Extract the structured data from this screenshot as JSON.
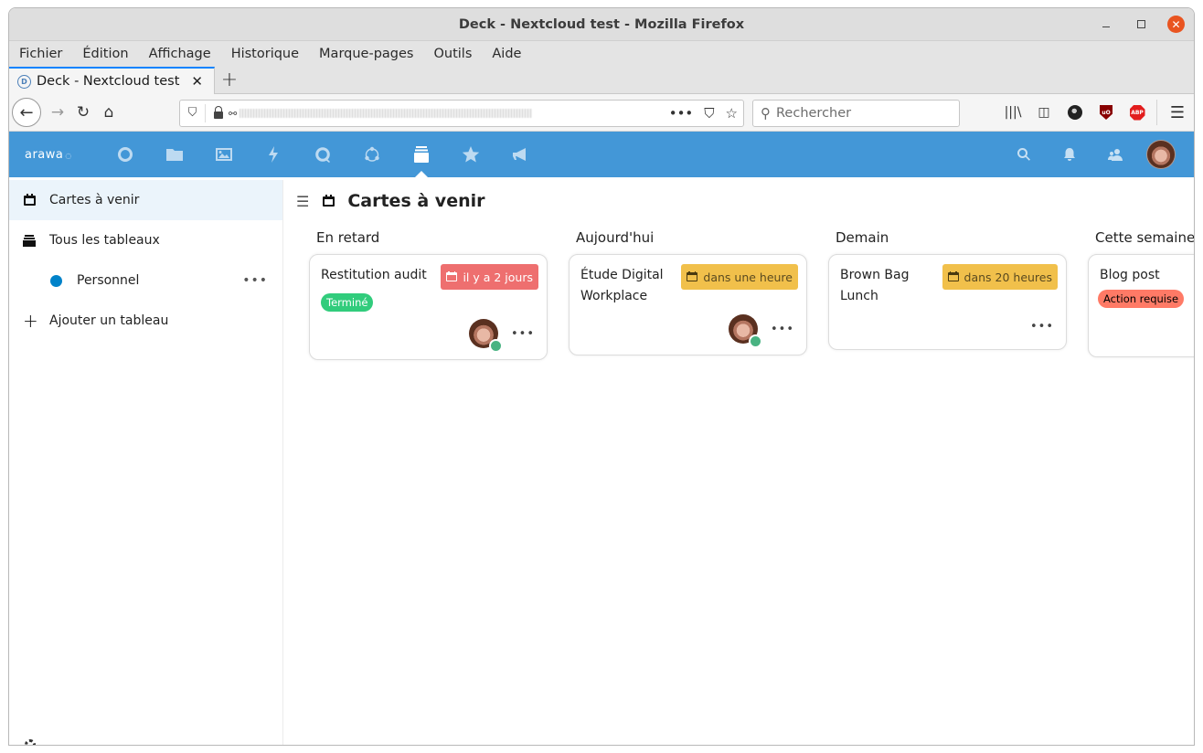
{
  "window": {
    "title": "Deck - Nextcloud test - Mozilla Firefox"
  },
  "menubar": {
    "items": [
      "Fichier",
      "Édition",
      "Affichage",
      "Historique",
      "Marque-pages",
      "Outils",
      "Aide"
    ]
  },
  "tabs": [
    {
      "title": "Deck - Nextcloud test",
      "icon": "deck-favicon",
      "active": true
    }
  ],
  "navbar": {
    "search_placeholder": "Rechercher",
    "url_obscured": true
  },
  "nextcloud": {
    "logo": "arawa",
    "apps": [
      {
        "name": "dashboard",
        "icon": "circle-icon",
        "active": false
      },
      {
        "name": "files",
        "icon": "folder-icon",
        "active": false
      },
      {
        "name": "photos",
        "icon": "image-icon",
        "active": false
      },
      {
        "name": "activity",
        "icon": "bolt-icon",
        "active": false
      },
      {
        "name": "talk",
        "icon": "talk-icon",
        "active": false
      },
      {
        "name": "circles",
        "icon": "circles-icon",
        "active": false
      },
      {
        "name": "deck",
        "icon": "deck-icon",
        "active": true
      },
      {
        "name": "favorites",
        "icon": "star-icon",
        "active": false
      },
      {
        "name": "announcements",
        "icon": "megaphone-icon",
        "active": false
      }
    ],
    "accent": "#4397d7"
  },
  "sidebar": {
    "items": [
      {
        "label": "Cartes à venir",
        "icon": "calendar-icon",
        "active": true
      },
      {
        "label": "Tous les tableaux",
        "icon": "deck-icon",
        "active": false
      },
      {
        "label": "Personnel",
        "icon": "board-color-dot",
        "color": "#0082c9",
        "sub": true
      },
      {
        "label": "Ajouter un tableau",
        "icon": "plus-icon",
        "active": false
      }
    ]
  },
  "main": {
    "title": "Cartes à venir",
    "stacks": [
      {
        "title": "En retard",
        "cards": [
          {
            "title": "Restitution audit",
            "due": "il y a 2 jours",
            "due_state": "overdue",
            "labels": [
              {
                "text": "Terminé",
                "bg": "#31cc7c",
                "fg": "#ffffff"
              }
            ],
            "has_assignee": true
          }
        ]
      },
      {
        "title": "Aujourd'hui",
        "cards": [
          {
            "title": "Étude Digital Workplace",
            "due": "dans une heure",
            "due_state": "soon",
            "labels": [],
            "has_assignee": true
          }
        ]
      },
      {
        "title": "Demain",
        "cards": [
          {
            "title": "Brown Bag Lunch",
            "due": "dans 20 heures",
            "due_state": "soon",
            "labels": [],
            "has_assignee": false
          }
        ]
      },
      {
        "title": "Cette semaine",
        "cards": [
          {
            "title": "Blog post",
            "due": null,
            "labels": [
              {
                "text": "Action requise",
                "bg": "#ff7a66",
                "fg": "#000000"
              }
            ],
            "has_assignee": false
          }
        ]
      }
    ]
  }
}
